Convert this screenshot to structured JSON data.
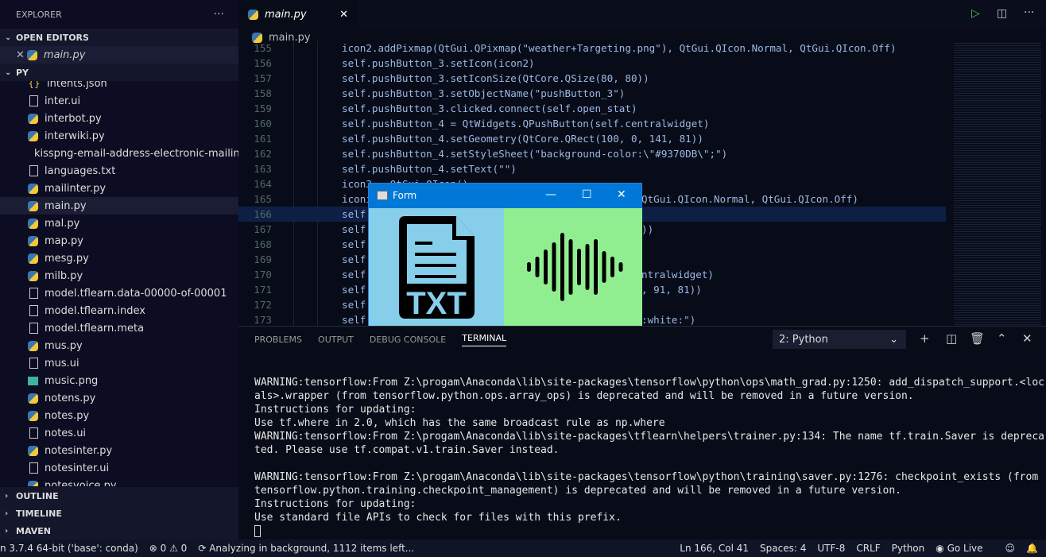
{
  "sidebar": {
    "title": "EXPLORER",
    "more": "···",
    "open_editors": "OPEN EDITORS",
    "open_file": "main.py",
    "folder": "PY",
    "files": [
      {
        "name": "intents.json",
        "icon": "json"
      },
      {
        "name": "inter.ui",
        "icon": "file"
      },
      {
        "name": "interbot.py",
        "icon": "python"
      },
      {
        "name": "interwiki.py",
        "icon": "python"
      },
      {
        "name": "kisspng-email-address-electronic-mailin...",
        "icon": "image"
      },
      {
        "name": "languages.txt",
        "icon": "text"
      },
      {
        "name": "mailinter.py",
        "icon": "python"
      },
      {
        "name": "main.py",
        "icon": "python"
      },
      {
        "name": "mal.py",
        "icon": "python"
      },
      {
        "name": "map.py",
        "icon": "python"
      },
      {
        "name": "mesg.py",
        "icon": "python"
      },
      {
        "name": "milb.py",
        "icon": "python"
      },
      {
        "name": "model.tflearn.data-00000-of-00001",
        "icon": "file"
      },
      {
        "name": "model.tflearn.index",
        "icon": "file"
      },
      {
        "name": "model.tflearn.meta",
        "icon": "file"
      },
      {
        "name": "mus.py",
        "icon": "python"
      },
      {
        "name": "mus.ui",
        "icon": "file"
      },
      {
        "name": "music.png",
        "icon": "image"
      },
      {
        "name": "notens.py",
        "icon": "python"
      },
      {
        "name": "notes.py",
        "icon": "python"
      },
      {
        "name": "notes.ui",
        "icon": "file"
      },
      {
        "name": "notesinter.py",
        "icon": "python"
      },
      {
        "name": "notesinter.ui",
        "icon": "file"
      },
      {
        "name": "notesvoice.py",
        "icon": "python"
      }
    ],
    "bottom": [
      "OUTLINE",
      "TIMELINE",
      "MAVEN"
    ]
  },
  "tab": {
    "label": "main.py"
  },
  "breadcrumb": "main.py",
  "code": [
    {
      "n": "155",
      "t": "icon2.addPixmap(QtGui.QPixmap(\"weather+Targeting.png\"), QtGui.QIcon.Normal, QtGui.QIcon.Off)"
    },
    {
      "n": "156",
      "t": "self.pushButton_3.setIcon(icon2)"
    },
    {
      "n": "157",
      "t": "self.pushButton_3.setIconSize(QtCore.QSize(80, 80))"
    },
    {
      "n": "158",
      "t": "self.pushButton_3.setObjectName(\"pushButton_3\")"
    },
    {
      "n": "159",
      "t": "self.pushButton_3.clicked.connect(self.open_stat)"
    },
    {
      "n": "160",
      "t": "self.pushButton_4 = QtWidgets.QPushButton(self.centralwidget)"
    },
    {
      "n": "161",
      "t": "self.pushButton_4.setGeometry(QtCore.QRect(100, 0, 141, 81))"
    },
    {
      "n": "162",
      "t": "self.pushButton_4.setStyleSheet(\"background-color:\\\"#9370DB\\\";\")"
    },
    {
      "n": "163",
      "t": "self.pushButton_4.setText(\"\")"
    },
    {
      "n": "164",
      "t": "icon3 = QtGui.QIcon()"
    },
    {
      "n": "165",
      "t": "iconi",
      "s": "QtGui.QIcon.Normal, QtGui.QIcon.Off)"
    },
    {
      "n": "166",
      "t": "self",
      "s": ""
    },
    {
      "n": "167",
      "t": "self",
      "s": "))"
    },
    {
      "n": "168",
      "t": "self",
      "s": ""
    },
    {
      "n": "169",
      "t": "self",
      "s": ""
    },
    {
      "n": "170",
      "t": "self",
      "s": "ntralwidget)"
    },
    {
      "n": "171",
      "t": "self",
      "s": ", 91, 81))"
    },
    {
      "n": "172",
      "t": "self",
      "s": ""
    },
    {
      "n": "173",
      "t": "self",
      "s": ":white:\")"
    }
  ],
  "form": {
    "title": "Form",
    "left_icon": "txt-file-icon",
    "right_icon": "sound-wave-icon",
    "left_bg": "#87ceeb",
    "right_bg": "#90ee90"
  },
  "panel": {
    "tabs": [
      "PROBLEMS",
      "OUTPUT",
      "DEBUG CONSOLE",
      "TERMINAL"
    ],
    "active": "TERMINAL",
    "terminal_select": "2: Python",
    "terminal": "WARNING:tensorflow:From Z:\\progam\\Anaconda\\lib\\site-packages\\tensorflow\\python\\ops\\math_grad.py:1250: add_dispatch_support.<loc\nals>.wrapper (from tensorflow.python.ops.array_ops) is deprecated and will be removed in a future version.\nInstructions for updating:\nUse tf.where in 2.0, which has the same broadcast rule as np.where\nWARNING:tensorflow:From Z:\\progam\\Anaconda\\lib\\site-packages\\tflearn\\helpers\\trainer.py:134: The name tf.train.Saver is depreca\nted. Please use tf.compat.v1.train.Saver instead.\n\nWARNING:tensorflow:From Z:\\progam\\Anaconda\\lib\\site-packages\\tensorflow\\python\\training\\saver.py:1276: checkpoint_exists (from\ntensorflow.python.training.checkpoint_management) is deprecated and will be removed in a future version.\nInstructions for updating:\nUse standard file APIs to check for files with this prefix.\n"
  },
  "status": {
    "interpreter": "n 3.7.4 64-bit ('base': conda)",
    "errors": "⊗ 0 ⚠ 0",
    "analyzing": "Analyzing in background, 1112 items left...",
    "position": "Ln 166, Col 41",
    "spaces": "Spaces: 4",
    "encoding": "UTF-8",
    "eol": "CRLF",
    "language": "Python",
    "golive": "Go Live"
  }
}
